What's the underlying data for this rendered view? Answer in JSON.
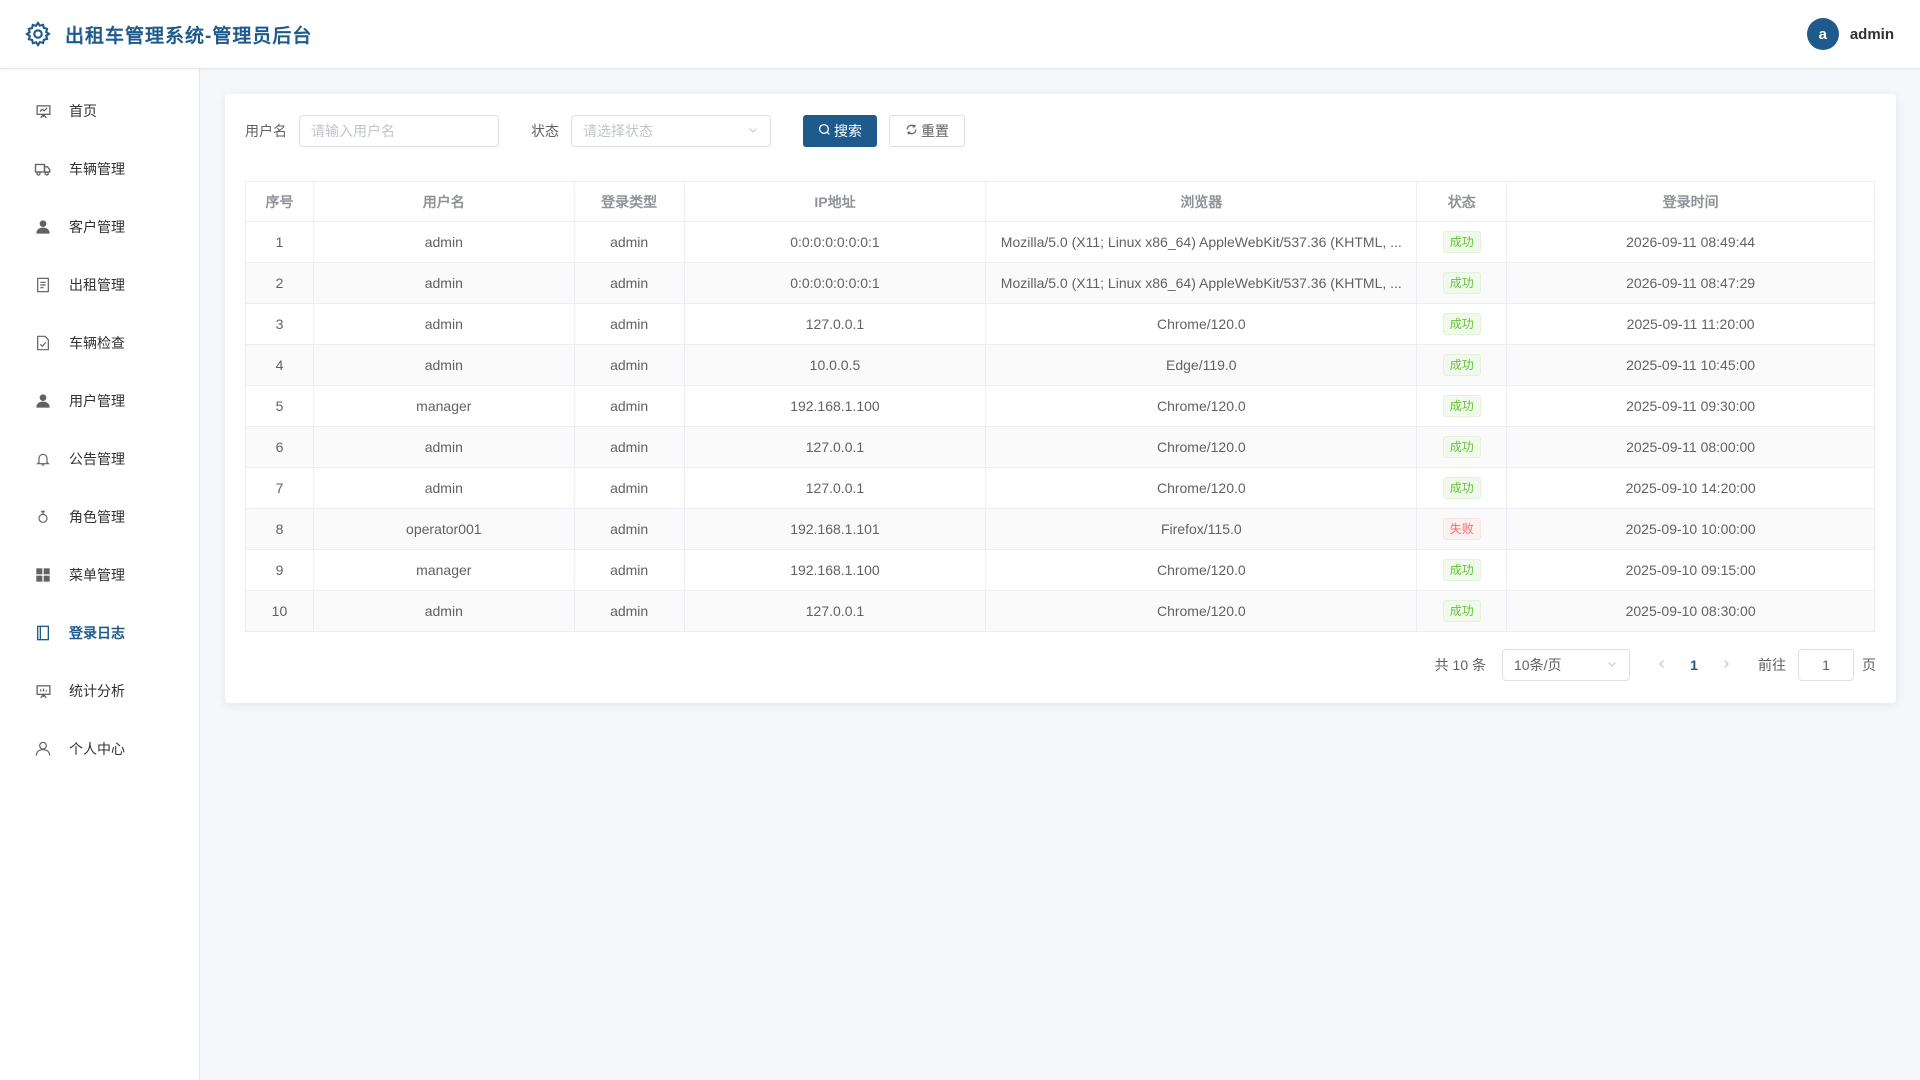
{
  "header": {
    "title": "出租车管理系统-管理员后台",
    "avatar_letter": "a",
    "username": "admin"
  },
  "sidebar": {
    "items": [
      {
        "label": "首页",
        "icon": "presentation-icon"
      },
      {
        "label": "车辆管理",
        "icon": "truck-icon"
      },
      {
        "label": "客户管理",
        "icon": "user-filled-icon"
      },
      {
        "label": "出租管理",
        "icon": "document-icon"
      },
      {
        "label": "车辆检查",
        "icon": "document-checked-icon"
      },
      {
        "label": "用户管理",
        "icon": "user-filled-icon"
      },
      {
        "label": "公告管理",
        "icon": "bell-icon"
      },
      {
        "label": "角色管理",
        "icon": "female-icon"
      },
      {
        "label": "菜单管理",
        "icon": "grid-icon"
      },
      {
        "label": "登录日志",
        "icon": "notebook-icon",
        "active": true
      },
      {
        "label": "统计分析",
        "icon": "data-board-icon"
      },
      {
        "label": "个人中心",
        "icon": "user-icon"
      }
    ]
  },
  "filters": {
    "username_label": "用户名",
    "username_placeholder": "请输入用户名",
    "status_label": "状态",
    "status_placeholder": "请选择状态",
    "search_label": "搜索",
    "reset_label": "重置"
  },
  "table": {
    "columns": [
      "序号",
      "用户名",
      "登录类型",
      "IP地址",
      "浏览器",
      "状态",
      "登录时间"
    ],
    "rows": [
      {
        "idx": "1",
        "user": "admin",
        "type": "admin",
        "ip": "0:0:0:0:0:0:0:1",
        "browser": "Mozilla/5.0 (X11; Linux x86_64) AppleWebKit/537.36 (KHTML, ...",
        "status": "成功",
        "ok": true,
        "time": "2026-09-11 08:49:44"
      },
      {
        "idx": "2",
        "user": "admin",
        "type": "admin",
        "ip": "0:0:0:0:0:0:0:1",
        "browser": "Mozilla/5.0 (X11; Linux x86_64) AppleWebKit/537.36 (KHTML, ...",
        "status": "成功",
        "ok": true,
        "time": "2026-09-11 08:47:29"
      },
      {
        "idx": "3",
        "user": "admin",
        "type": "admin",
        "ip": "127.0.0.1",
        "browser": "Chrome/120.0",
        "status": "成功",
        "ok": true,
        "time": "2025-09-11 11:20:00"
      },
      {
        "idx": "4",
        "user": "admin",
        "type": "admin",
        "ip": "10.0.0.5",
        "browser": "Edge/119.0",
        "status": "成功",
        "ok": true,
        "time": "2025-09-11 10:45:00"
      },
      {
        "idx": "5",
        "user": "manager",
        "type": "admin",
        "ip": "192.168.1.100",
        "browser": "Chrome/120.0",
        "status": "成功",
        "ok": true,
        "time": "2025-09-11 09:30:00"
      },
      {
        "idx": "6",
        "user": "admin",
        "type": "admin",
        "ip": "127.0.0.1",
        "browser": "Chrome/120.0",
        "status": "成功",
        "ok": true,
        "time": "2025-09-11 08:00:00"
      },
      {
        "idx": "7",
        "user": "admin",
        "type": "admin",
        "ip": "127.0.0.1",
        "browser": "Chrome/120.0",
        "status": "成功",
        "ok": true,
        "time": "2025-09-10 14:20:00"
      },
      {
        "idx": "8",
        "user": "operator001",
        "type": "admin",
        "ip": "192.168.1.101",
        "browser": "Firefox/115.0",
        "status": "失败",
        "ok": false,
        "time": "2025-09-10 10:00:00"
      },
      {
        "idx": "9",
        "user": "manager",
        "type": "admin",
        "ip": "192.168.1.100",
        "browser": "Chrome/120.0",
        "status": "成功",
        "ok": true,
        "time": "2025-09-10 09:15:00"
      },
      {
        "idx": "10",
        "user": "admin",
        "type": "admin",
        "ip": "127.0.0.1",
        "browser": "Chrome/120.0",
        "status": "成功",
        "ok": true,
        "time": "2025-09-10 08:30:00"
      }
    ]
  },
  "pagination": {
    "total": "共 10 条",
    "page_size": "10条/页",
    "current_page": "1",
    "goto_label": "前往",
    "goto_value": "1",
    "page_suffix": "页"
  },
  "colors": {
    "brand": "#1f5a8c",
    "success": "#67c23a",
    "danger": "#f56c6c"
  }
}
